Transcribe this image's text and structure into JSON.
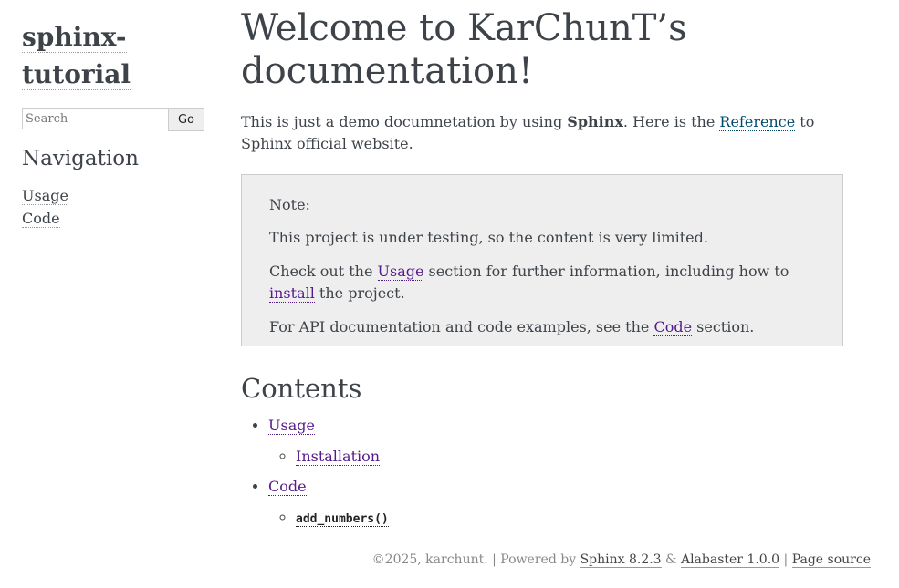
{
  "sidebar": {
    "logo_line1": "sphinx-",
    "logo_line2": "tutorial",
    "search_placeholder": "Search",
    "go_label": "Go",
    "nav_heading": "Navigation",
    "nav_items": [
      "Usage",
      "Code"
    ]
  },
  "main": {
    "title": "Welcome to KarChunT’s documentation!",
    "intro": {
      "part1": "This is just a demo documnetation by using ",
      "bold": "Sphinx",
      "part2": ". Here is the ",
      "link": "Reference",
      "part3": " to Sphinx official website."
    },
    "note": {
      "title": "Note:",
      "p1": "This project is under testing, so the content is very limited.",
      "p2_a": "Check out the ",
      "p2_link1": "Usage",
      "p2_b": " section for further information, including how to ",
      "p2_link2": "install",
      "p2_c": " the project.",
      "p3_a": "For API documentation and code examples, see the ",
      "p3_link": "Code",
      "p3_b": " section."
    },
    "contents_heading": "Contents",
    "toc": [
      {
        "label": "Usage",
        "children": [
          "Installation"
        ]
      },
      {
        "label": "Code",
        "children": [
          "add_numbers()"
        ]
      }
    ]
  },
  "footer": {
    "copyright": "©2025, karchunt. | Powered by ",
    "sphinx": "Sphinx 8.2.3",
    "amp": " & ",
    "alabaster": "Alabaster 1.0.0",
    "sep": " | ",
    "source": "Page source"
  }
}
